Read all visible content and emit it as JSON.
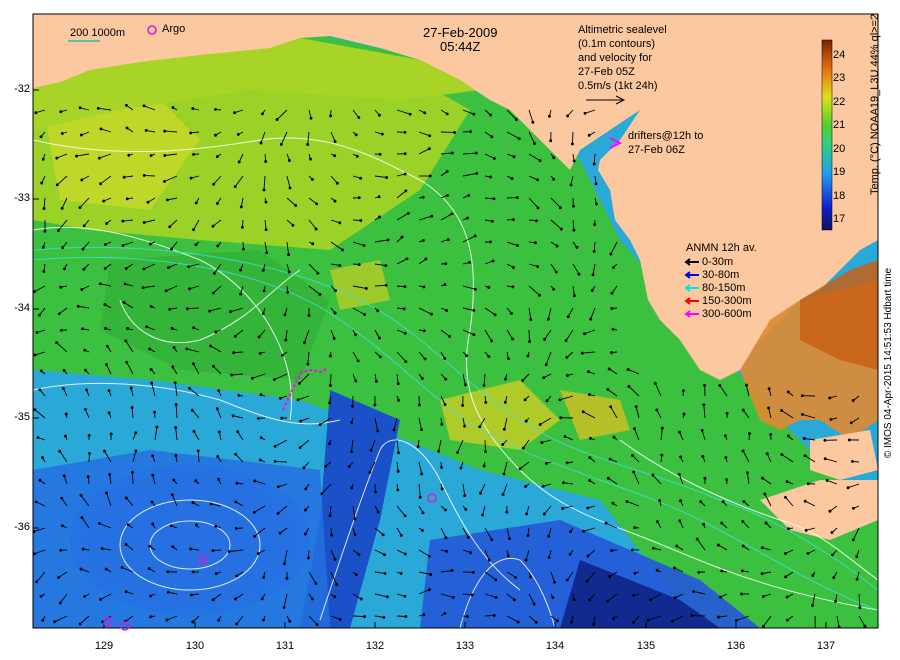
{
  "title": {
    "date": "27-Feb-2009",
    "time": "05:44Z"
  },
  "scale_bar": {
    "label": "200  1000m"
  },
  "argo": {
    "label": "Argo",
    "color": "#d020d0"
  },
  "altimetry": {
    "lines": [
      "Altimetric sealevel",
      "(0.1m contours)",
      "and velocity for",
      "27-Feb 05Z",
      "0.5m/s (1kt 24h)"
    ]
  },
  "drifters": {
    "line1": "drifters@12h to",
    "line2": "27-Feb 06Z",
    "color": "#ff00ff"
  },
  "anmn": {
    "title": "ANMN 12h av.",
    "items": [
      {
        "label": "0-30m",
        "color": "#000000"
      },
      {
        "label": "30-80m",
        "color": "#0000ff"
      },
      {
        "label": "80-150m",
        "color": "#00e5e5"
      },
      {
        "label": "150-300m",
        "color": "#ff0000"
      },
      {
        "label": "300-600m",
        "color": "#ff00ff"
      }
    ]
  },
  "axes": {
    "lat_ticks": [
      "-32",
      "-33",
      "-34",
      "-35",
      "-36"
    ],
    "lon_ticks": [
      "129",
      "130",
      "131",
      "132",
      "133",
      "134",
      "135",
      "136",
      "137"
    ]
  },
  "colorbar": {
    "label": "Temp. (°C) NOAA19_L3U 44% ql>=2",
    "ticks": [
      "24",
      "23",
      "22",
      "21",
      "20",
      "19",
      "18",
      "17"
    ],
    "range": [
      16.5,
      24.5
    ]
  },
  "credit": "© IMOS 04-Apr-2015 14:51:53 Hdbart time",
  "colors": {
    "land": "#fcc8a0",
    "warm": "#c84000",
    "mid": "#2ab82a",
    "cool": "#2060e0"
  }
}
